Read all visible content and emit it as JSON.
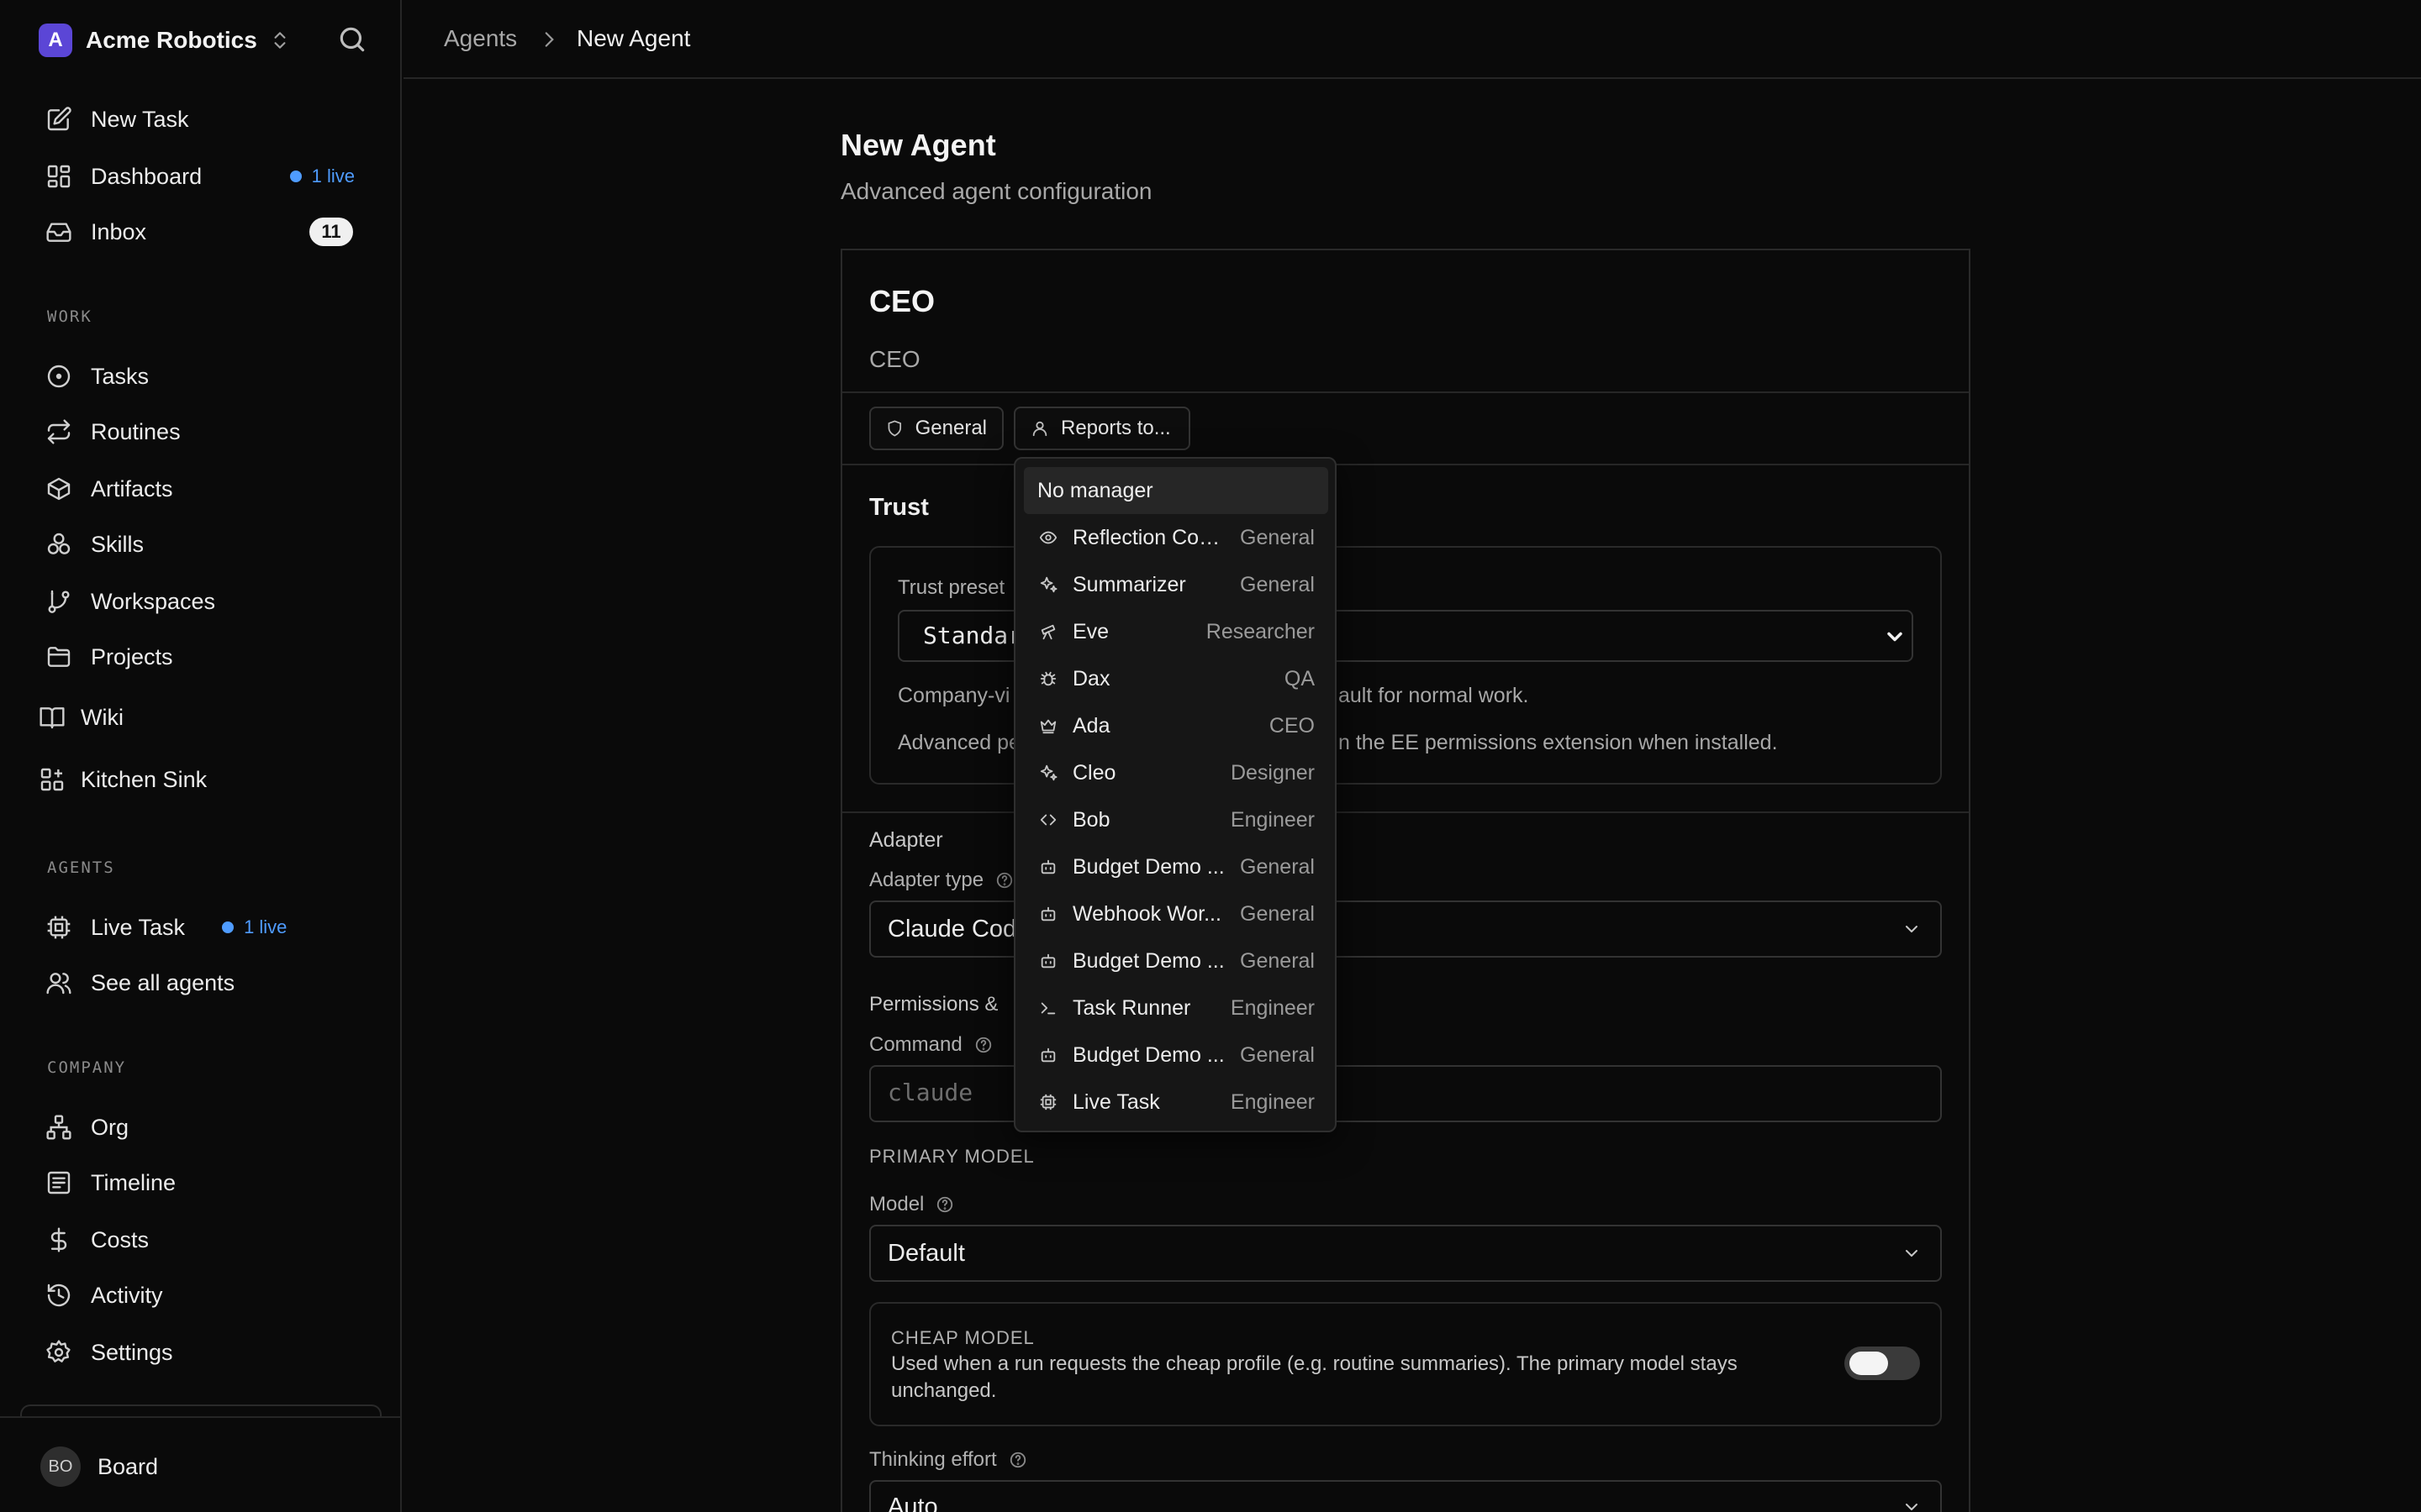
{
  "sidebar": {
    "company": "Acme Robotics",
    "logo_letter": "A",
    "items": [
      {
        "label": "New Task",
        "icon": "pencil-square-icon"
      },
      {
        "label": "Dashboard",
        "icon": "dashboard-icon",
        "status": "1 live"
      },
      {
        "label": "Inbox",
        "icon": "inbox-icon",
        "badge": "11"
      }
    ],
    "sections": {
      "work": "WORK",
      "agents": "AGENTS",
      "company": "COMPANY"
    },
    "work_items": [
      {
        "label": "Tasks",
        "icon": "circle-dot-icon"
      },
      {
        "label": "Routines",
        "icon": "repeat-icon"
      },
      {
        "label": "Artifacts",
        "icon": "box-icon"
      },
      {
        "label": "Skills",
        "icon": "boxes-icon"
      },
      {
        "label": "Workspaces",
        "icon": "git-branch-icon"
      },
      {
        "label": "Projects",
        "icon": "folder-icon"
      }
    ],
    "wiki": {
      "label": "Wiki",
      "icon": "book-icon"
    },
    "kitchen_sink": {
      "label": "Kitchen Sink",
      "icon": "grid-plus-icon"
    },
    "agent_items": [
      {
        "label": "Live Task",
        "icon": "cpu-icon",
        "status": "1 live"
      },
      {
        "label": "See all agents",
        "icon": "users-icon"
      }
    ],
    "company_items": [
      {
        "label": "Org",
        "icon": "org-chart-icon"
      },
      {
        "label": "Timeline",
        "icon": "timeline-icon"
      },
      {
        "label": "Costs",
        "icon": "dollar-icon"
      },
      {
        "label": "Activity",
        "icon": "history-icon"
      },
      {
        "label": "Settings",
        "icon": "gear-icon"
      }
    ],
    "user": {
      "initials": "BO",
      "name": "Board"
    }
  },
  "header": {
    "breadcrumb": [
      "Agents",
      "New Agent"
    ]
  },
  "main": {
    "title": "New Agent",
    "subtitle": "Advanced agent configuration",
    "agent": {
      "name": "CEO",
      "title": "CEO"
    },
    "chips": {
      "role": "General",
      "reports_to": "Reports to..."
    },
    "trust": {
      "heading": "Trust",
      "preset_label": "Trust preset",
      "preset_value": "Standar",
      "desc_start": "Company-vi",
      "desc_end": "ault for normal work.",
      "note_start": "Advanced pe",
      "note_end": "n the EE permissions extension when installed."
    },
    "adapter": {
      "heading": "Adapter",
      "type_label": "Adapter type",
      "type_value": "Claude Cod",
      "permissions_label": "Permissions &",
      "command_label": "Command",
      "command_placeholder": "claude",
      "primary_model_heading": "PRIMARY MODEL",
      "model_label": "Model",
      "model_value": "Default",
      "cheap_model_heading": "CHEAP MODEL",
      "cheap_model_desc": "Used when a run requests the cheap profile (e.g. routine summaries). The primary model stays unchanged.",
      "cheap_model_enabled": false,
      "thinking_label": "Thinking effort",
      "thinking_value": "Auto"
    }
  },
  "dropdown": {
    "first": "No manager",
    "items": [
      {
        "name": "Reflection Coa...",
        "role": "General",
        "icon": "eye-icon"
      },
      {
        "name": "Summarizer",
        "role": "General",
        "icon": "sparkles-icon"
      },
      {
        "name": "Eve",
        "role": "Researcher",
        "icon": "telescope-icon"
      },
      {
        "name": "Dax",
        "role": "QA",
        "icon": "bug-icon"
      },
      {
        "name": "Ada",
        "role": "CEO",
        "icon": "crown-icon"
      },
      {
        "name": "Cleo",
        "role": "Designer",
        "icon": "sparkles-icon"
      },
      {
        "name": "Bob",
        "role": "Engineer",
        "icon": "code-icon"
      },
      {
        "name": "Budget Demo ...",
        "role": "General",
        "icon": "bot-icon"
      },
      {
        "name": "Webhook Wor...",
        "role": "General",
        "icon": "bot-icon"
      },
      {
        "name": "Budget Demo ...",
        "role": "General",
        "icon": "bot-icon"
      },
      {
        "name": "Task Runner",
        "role": "Engineer",
        "icon": "terminal-icon"
      },
      {
        "name": "Budget Demo ...",
        "role": "General",
        "icon": "bot-icon"
      },
      {
        "name": "Live Task",
        "role": "Engineer",
        "icon": "cpu-icon"
      }
    ]
  }
}
